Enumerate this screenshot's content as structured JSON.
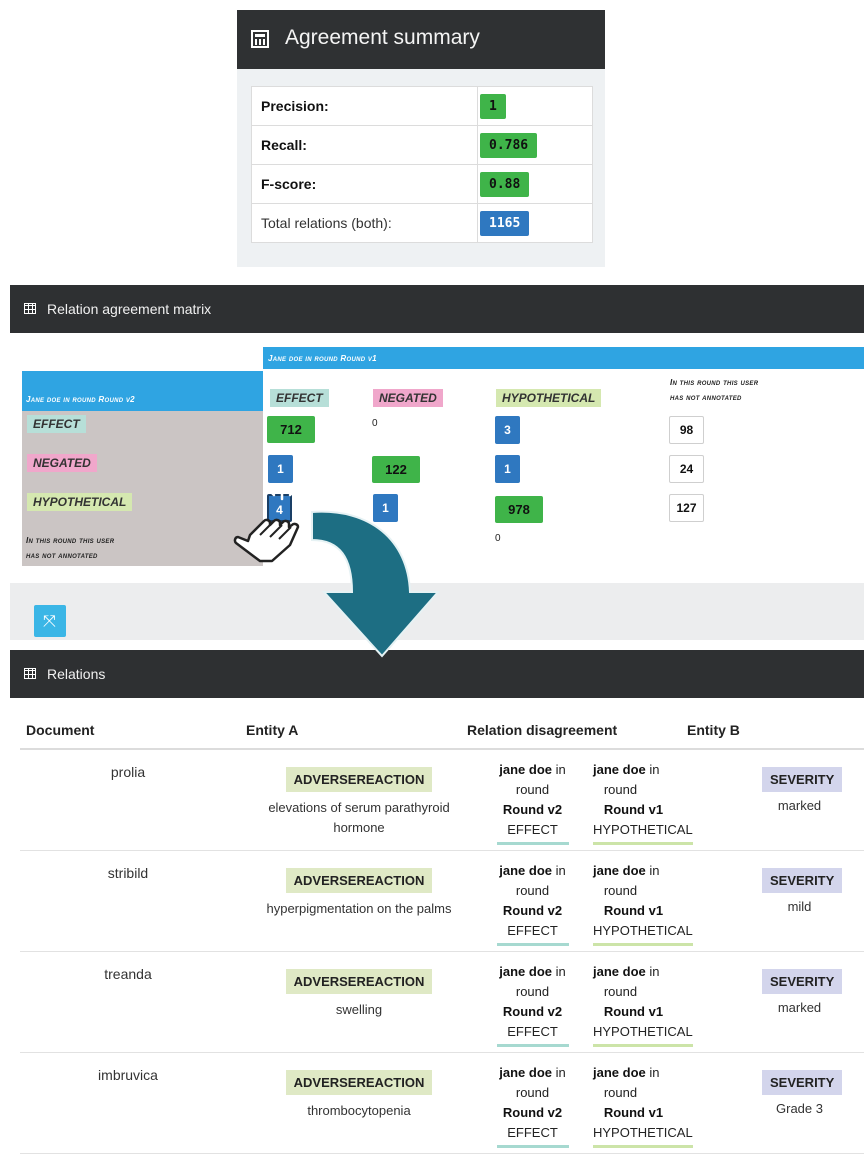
{
  "summary": {
    "title": "Agreement summary",
    "rows": [
      {
        "label": "Precision:",
        "value": "1"
      },
      {
        "label": "Recall:",
        "value": "0.786"
      },
      {
        "label": "F-score:",
        "value": "0.88"
      },
      {
        "label": "Total relations (both):",
        "value": "1165"
      }
    ]
  },
  "matrix": {
    "title": "Relation agreement matrix",
    "col_header": "Jane doe in round Round v1",
    "row_header": "Jane doe in round Round v2",
    "not_annotated_line1": "In this round this user",
    "not_annotated_line2": "has not annotated",
    "labels": {
      "effect": "EFFECT",
      "negated": "NEGATED",
      "hypothetical": "HYPOTHETICAL"
    },
    "cells": {
      "effect_effect": "712",
      "effect_negated": "0",
      "effect_hypo": "3",
      "effect_na": "98",
      "negated_effect": "1",
      "negated_negated": "122",
      "negated_hypo": "1",
      "negated_na": "24",
      "hypo_effect": "4",
      "hypo_negated": "1",
      "hypo_hypo": "978",
      "hypo_na": "127",
      "na_effect": "0",
      "na_hypo": "0"
    },
    "colors": {
      "green": "#3fb449",
      "blue": "#2f78c0",
      "header": "#2fa4e2"
    }
  },
  "relations": {
    "title": "Relations",
    "columns": {
      "document": "Document",
      "entity_a": "Entity A",
      "disagreement": "Relation disagreement",
      "entity_b": "Entity B"
    },
    "user": "jane doe",
    "in_text": "in",
    "round_text": "round",
    "round_a": "Round v2",
    "round_b": "Round v1",
    "rows": [
      {
        "document": "prolia",
        "entity_a_type": "ADVERSEREACTION",
        "entity_a_text": "elevations of serum parathyroid hormone",
        "label_a": "EFFECT",
        "label_b": "HYPOTHETICAL",
        "entity_b_type": "SEVERITY",
        "entity_b_text": "marked"
      },
      {
        "document": "stribild",
        "entity_a_type": "ADVERSEREACTION",
        "entity_a_text": "hyperpigmentation on the palms",
        "label_a": "EFFECT",
        "label_b": "HYPOTHETICAL",
        "entity_b_type": "SEVERITY",
        "entity_b_text": "mild"
      },
      {
        "document": "treanda",
        "entity_a_type": "ADVERSEREACTION",
        "entity_a_text": "swelling",
        "label_a": "EFFECT",
        "label_b": "HYPOTHETICAL",
        "entity_b_type": "SEVERITY",
        "entity_b_text": "marked"
      },
      {
        "document": "imbruvica",
        "entity_a_type": "ADVERSEREACTION",
        "entity_a_text": "thrombocytopenia",
        "label_a": "EFFECT",
        "label_b": "HYPOTHETICAL",
        "entity_b_type": "SEVERITY",
        "entity_b_text": "Grade 3"
      }
    ]
  },
  "icons": {
    "summary": "calculator-icon",
    "matrix": "table-icon",
    "relations": "table-icon",
    "fullscreen": "expand-icon",
    "arrow": "curved-arrow-icon",
    "cursor": "hand-pointer-icon"
  }
}
